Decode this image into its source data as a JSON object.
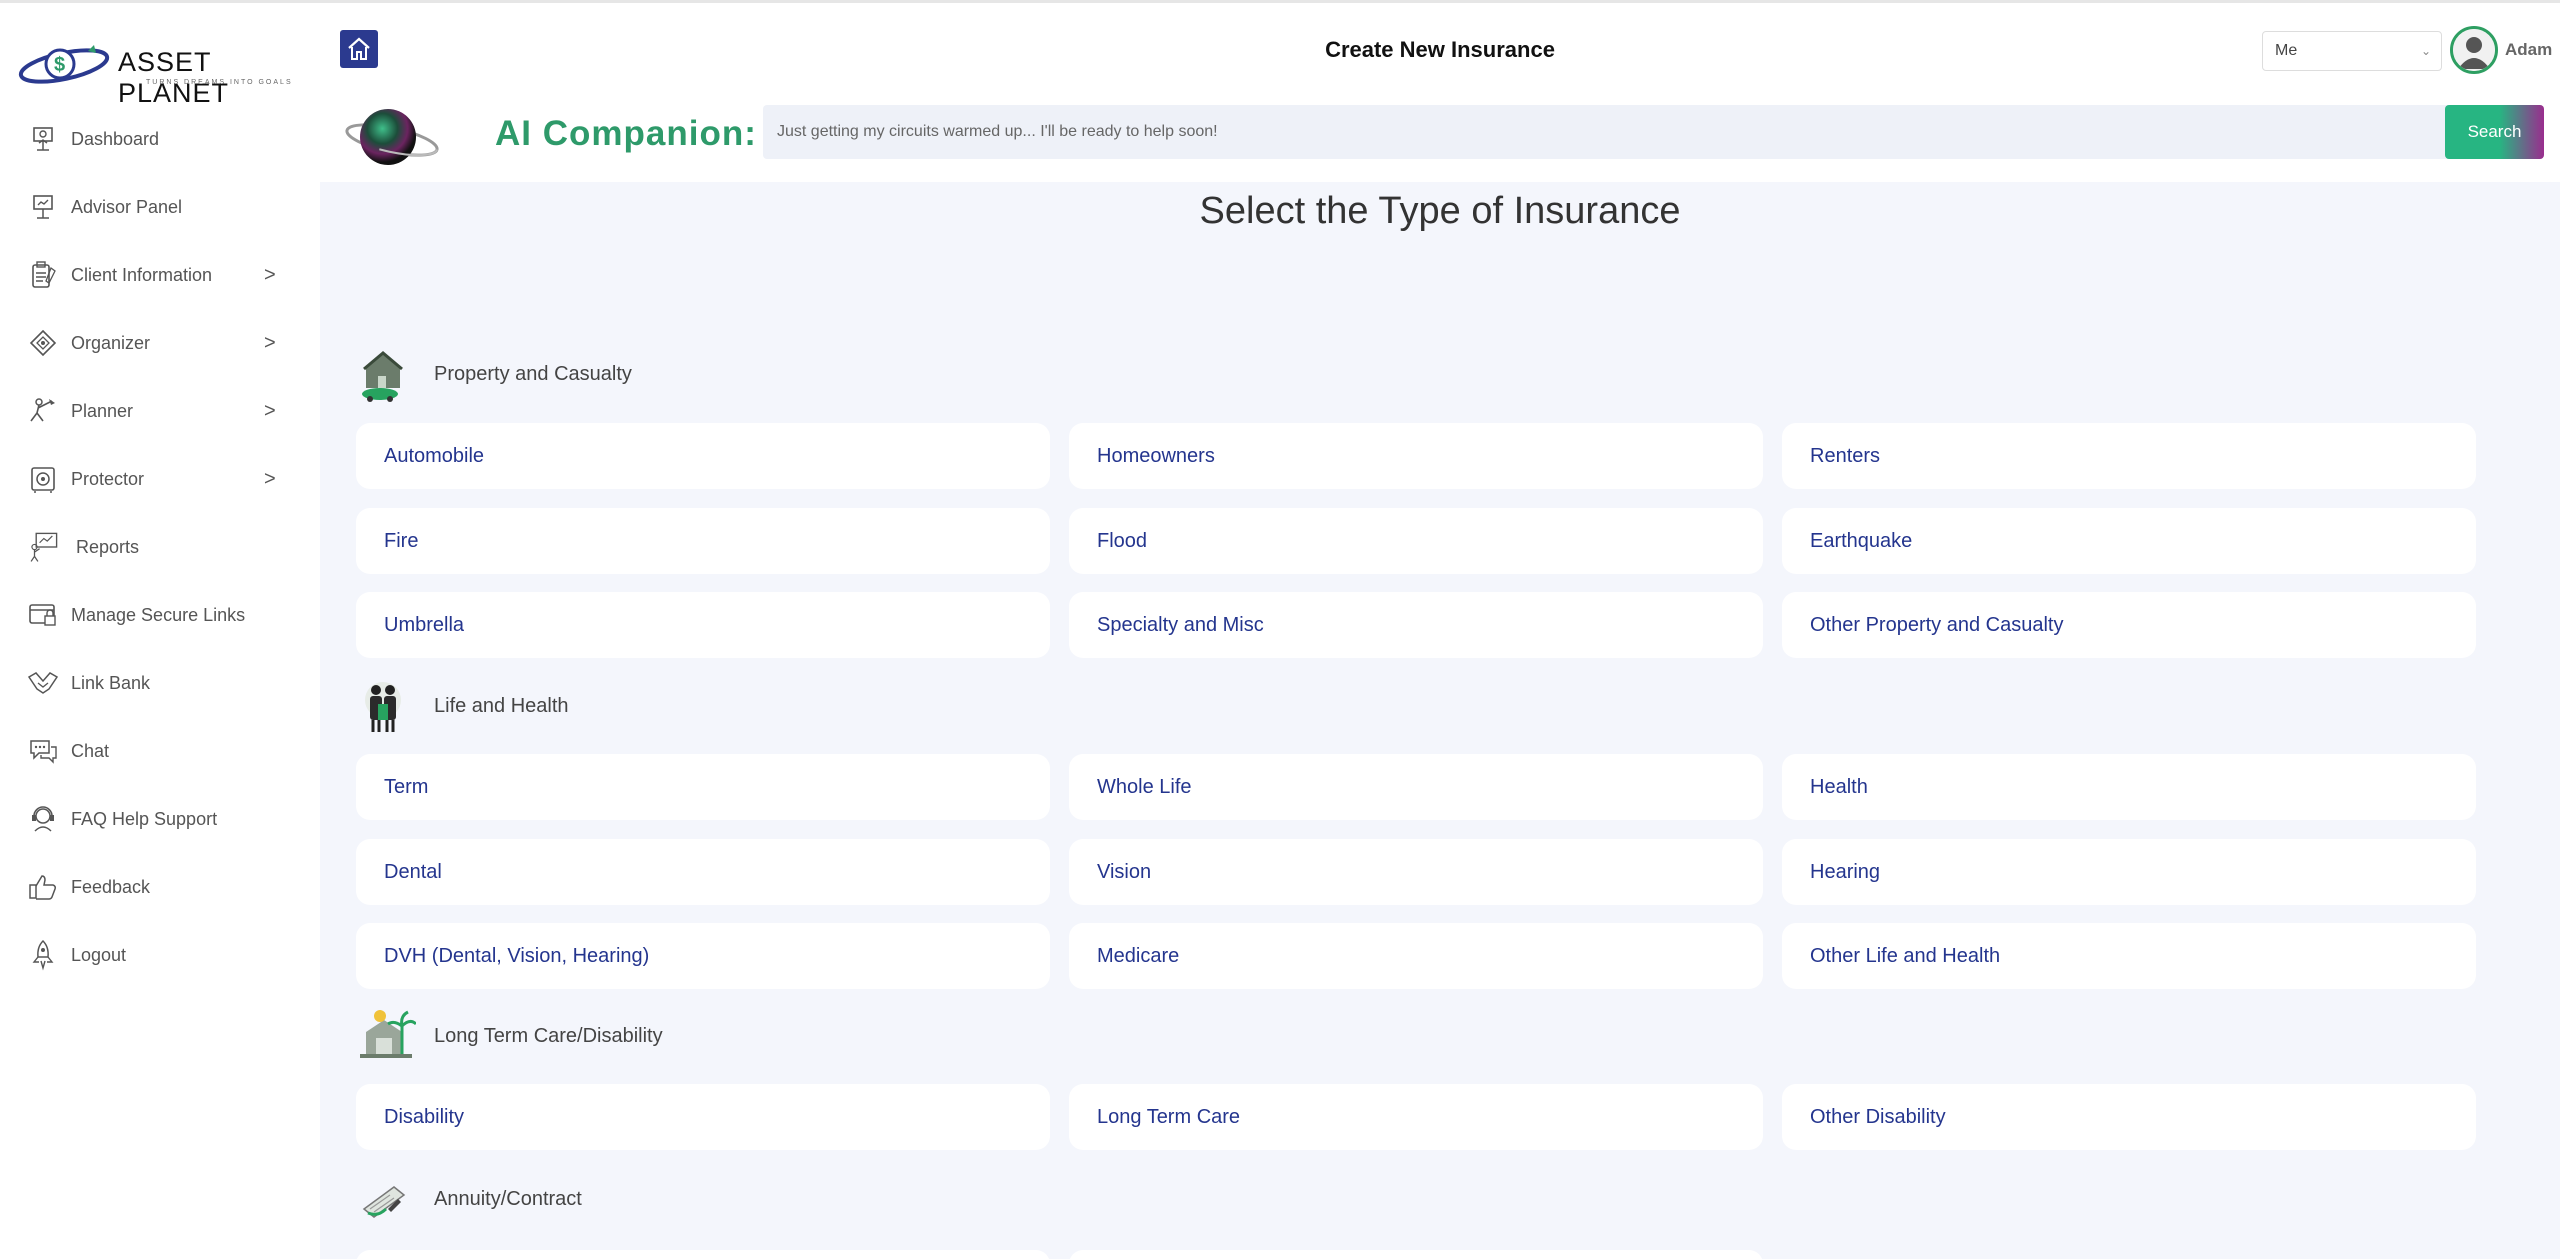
{
  "brand": {
    "name": "ASSET PLANET",
    "tagline": "TURNS DREAMS INTO GOALS"
  },
  "sidebar": {
    "items": [
      {
        "label": "Dashboard",
        "icon": "dashboard-icon",
        "has_submenu": false
      },
      {
        "label": "Advisor Panel",
        "icon": "advisor-panel-icon",
        "has_submenu": false
      },
      {
        "label": "Client Information",
        "icon": "client-information-icon",
        "has_submenu": true
      },
      {
        "label": "Organizer",
        "icon": "organizer-icon",
        "has_submenu": true
      },
      {
        "label": "Planner",
        "icon": "planner-icon",
        "has_submenu": true
      },
      {
        "label": "Protector",
        "icon": "protector-icon",
        "has_submenu": true
      },
      {
        "label": "Reports",
        "icon": "reports-icon",
        "has_submenu": false
      },
      {
        "label": "Manage Secure Links",
        "icon": "secure-links-icon",
        "has_submenu": false
      },
      {
        "label": "Link Bank",
        "icon": "link-bank-icon",
        "has_submenu": false
      },
      {
        "label": "Chat",
        "icon": "chat-icon",
        "has_submenu": false
      },
      {
        "label": "FAQ Help Support",
        "icon": "faq-icon",
        "has_submenu": false
      },
      {
        "label": "Feedback",
        "icon": "feedback-icon",
        "has_submenu": false
      },
      {
        "label": "Logout",
        "icon": "logout-icon",
        "has_submenu": false
      }
    ],
    "chevron": ">"
  },
  "header": {
    "title": "Create New Insurance",
    "member_select": "Me",
    "user_name": "Adam"
  },
  "ai": {
    "label": "AI Companion:",
    "placeholder": "Just getting my circuits warmed up... I'll be ready to help soon!",
    "search_label": "Search"
  },
  "main": {
    "title": "Select the Type of Insurance",
    "sections": [
      {
        "label": "Property and Casualty",
        "icon": "property-casualty-icon",
        "cards": [
          "Automobile",
          "Homeowners",
          "Renters",
          "Fire",
          "Flood",
          "Earthquake",
          "Umbrella",
          "Specialty and Misc",
          "Other Property and Casualty"
        ]
      },
      {
        "label": "Life and Health",
        "icon": "life-health-icon",
        "cards": [
          "Term",
          "Whole Life",
          "Health",
          "Dental",
          "Vision",
          "Hearing",
          "DVH (Dental, Vision, Hearing)",
          "Medicare",
          "Other Life and Health"
        ]
      },
      {
        "label": "Long Term Care/Disability",
        "icon": "long-term-care-icon",
        "cards": [
          "Disability",
          "Long Term Care",
          "Other Disability"
        ]
      },
      {
        "label": "Annuity/Contract",
        "icon": "annuity-contract-icon",
        "cards": []
      }
    ]
  },
  "colors": {
    "accent_green": "#2e9a6a",
    "card_text_blue": "#24358e",
    "home_button": "#2b3a8f",
    "main_background": "#f4f6fc"
  }
}
